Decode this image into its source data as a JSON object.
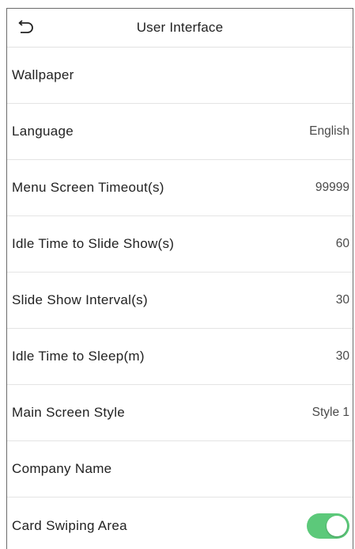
{
  "header": {
    "title": "User Interface",
    "back_icon": "back-arrow-icon"
  },
  "settings": [
    {
      "label": "Wallpaper",
      "value": ""
    },
    {
      "label": "Language",
      "value": "English"
    },
    {
      "label": "Menu Screen Timeout(s)",
      "value": "99999"
    },
    {
      "label": "Idle Time to Slide Show(s)",
      "value": "60"
    },
    {
      "label": "Slide Show Interval(s)",
      "value": "30"
    },
    {
      "label": "Idle Time to Sleep(m)",
      "value": "30"
    },
    {
      "label": "Main Screen Style",
      "value": "Style 1"
    },
    {
      "label": "Company Name",
      "value": ""
    },
    {
      "label": "Card Swiping Area",
      "toggle_on": true
    }
  ],
  "colors": {
    "toggle_on": "#5cc97a"
  }
}
